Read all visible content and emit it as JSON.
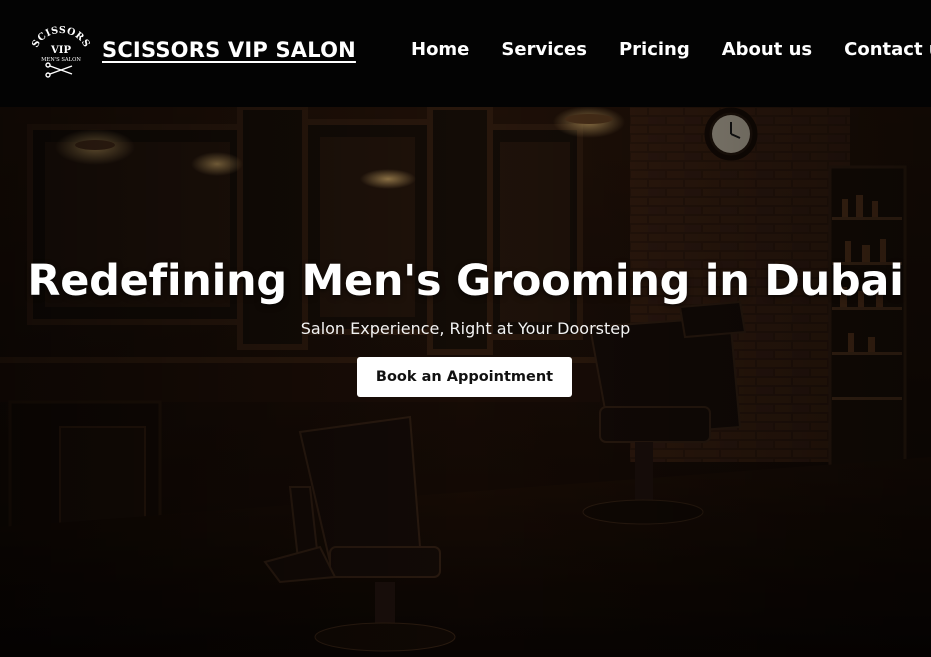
{
  "brand": {
    "name": "SCISSORS VIP SALON",
    "logo_top": "SCISSORS",
    "logo_mid": "VIP",
    "logo_bottom": "MEN'S SALON"
  },
  "nav": {
    "items": [
      {
        "label": "Home"
      },
      {
        "label": "Services"
      },
      {
        "label": "Pricing"
      },
      {
        "label": "About us"
      },
      {
        "label": "Contact us"
      }
    ]
  },
  "hero": {
    "title": "Redefining Men's Grooming in Dubai",
    "subtitle": "Salon Experience, Right at Your Doorstep",
    "cta_label": "Book an Appointment"
  },
  "colors": {
    "navbar_bg": "#030303",
    "hero_tint": "#2a160b",
    "cta_bg": "#ffffff",
    "text": "#ffffff"
  }
}
